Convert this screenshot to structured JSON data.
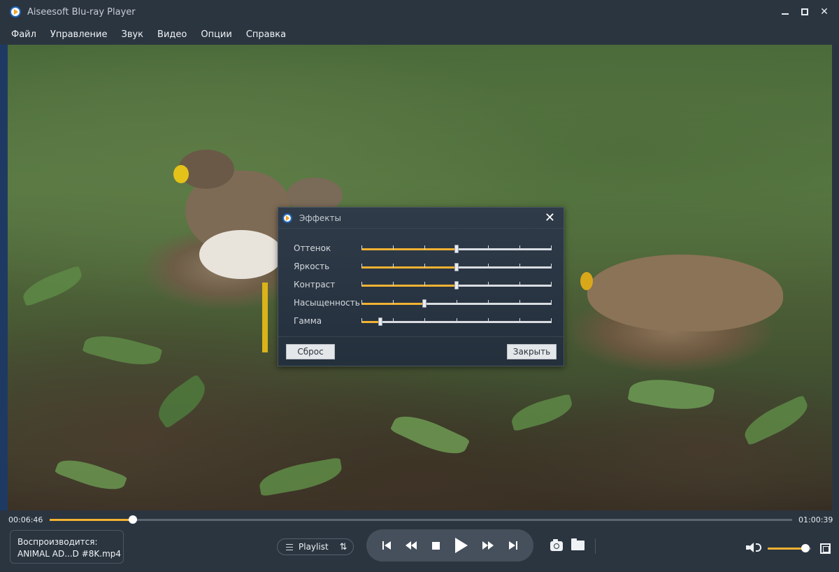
{
  "window": {
    "title": "Aiseesoft Blu-ray Player",
    "minimize_glyph": "minimize",
    "maximize_glyph": "maximize",
    "close_glyph": "✕"
  },
  "menu": {
    "items": [
      "Файл",
      "Управление",
      "Звук",
      "Видео",
      "Опции",
      "Справка"
    ]
  },
  "effects_dialog": {
    "title": "Эффекты",
    "close_glyph": "✕",
    "sliders": [
      {
        "label": "Оттенок",
        "value": 0.5
      },
      {
        "label": "Яркость",
        "value": 0.5
      },
      {
        "label": "Контраст",
        "value": 0.5
      },
      {
        "label": "Насыщенность",
        "value": 0.33
      },
      {
        "label": "Гамма",
        "value": 0.1
      }
    ],
    "reset_label": "Сброс",
    "close_label": "Закрыть"
  },
  "playback": {
    "current_time": "00:06:46",
    "total_time": "01:00:39",
    "progress": 0.112,
    "now_playing_label": "Воспроизводится:",
    "now_playing_file": "ANIMAL AD...D #8K.mp4",
    "playlist_label": "Playlist",
    "volume": 0.87
  },
  "colors": {
    "accent": "#f2b232",
    "panel": "#2b3540"
  },
  "icons": [
    "play-icon",
    "stop-icon",
    "rewind-icon",
    "fast-forward-icon",
    "previous-icon",
    "next-icon",
    "camera-icon",
    "folder-icon",
    "volume-icon",
    "fullscreen-icon",
    "playlist-icon",
    "sort-icon"
  ]
}
